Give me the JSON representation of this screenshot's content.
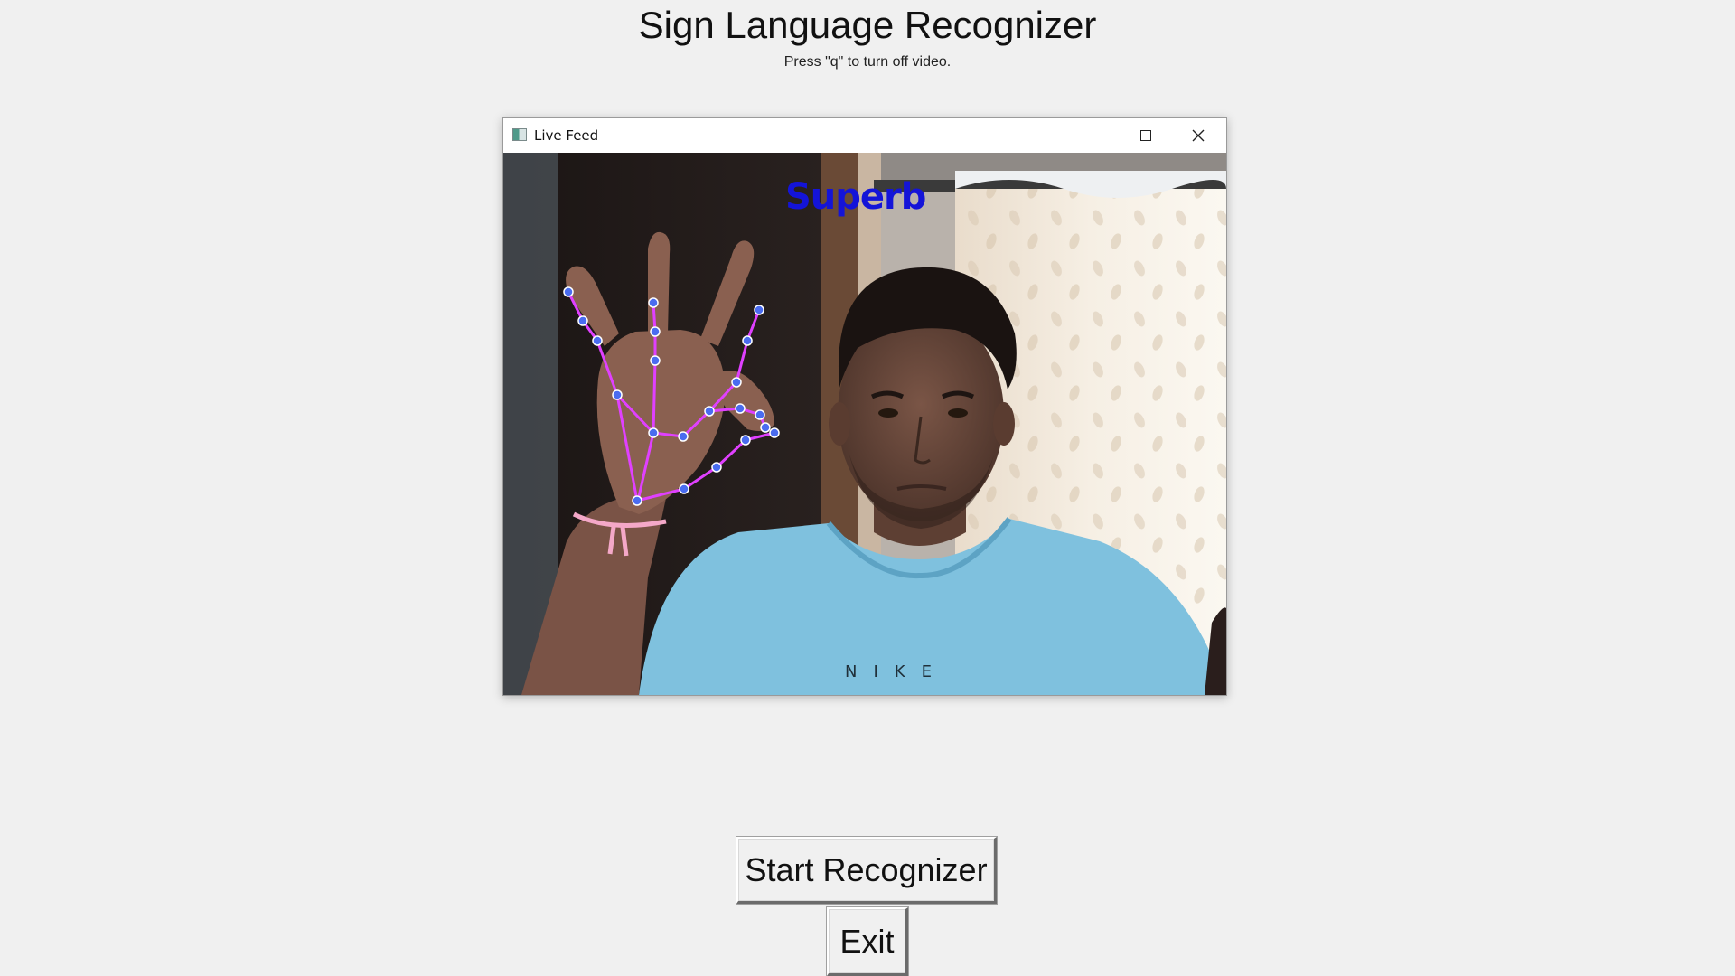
{
  "app": {
    "title": "Sign Language Recognizer",
    "subtitle": "Press \"q\" to turn off video."
  },
  "window": {
    "title": "Live Feed",
    "controls": {
      "minimize_icon": "minimize-icon",
      "maximize_icon": "maximize-icon",
      "close_icon": "close-icon"
    }
  },
  "video": {
    "prediction": "Superb",
    "prediction_color": "#1414d8",
    "landmark_line_color": "#e040ff",
    "landmark_point_color": "#4a6cf0",
    "shirt_text": "NIKE"
  },
  "buttons": {
    "start_label": "Start Recognizer",
    "exit_label": "Exit"
  }
}
